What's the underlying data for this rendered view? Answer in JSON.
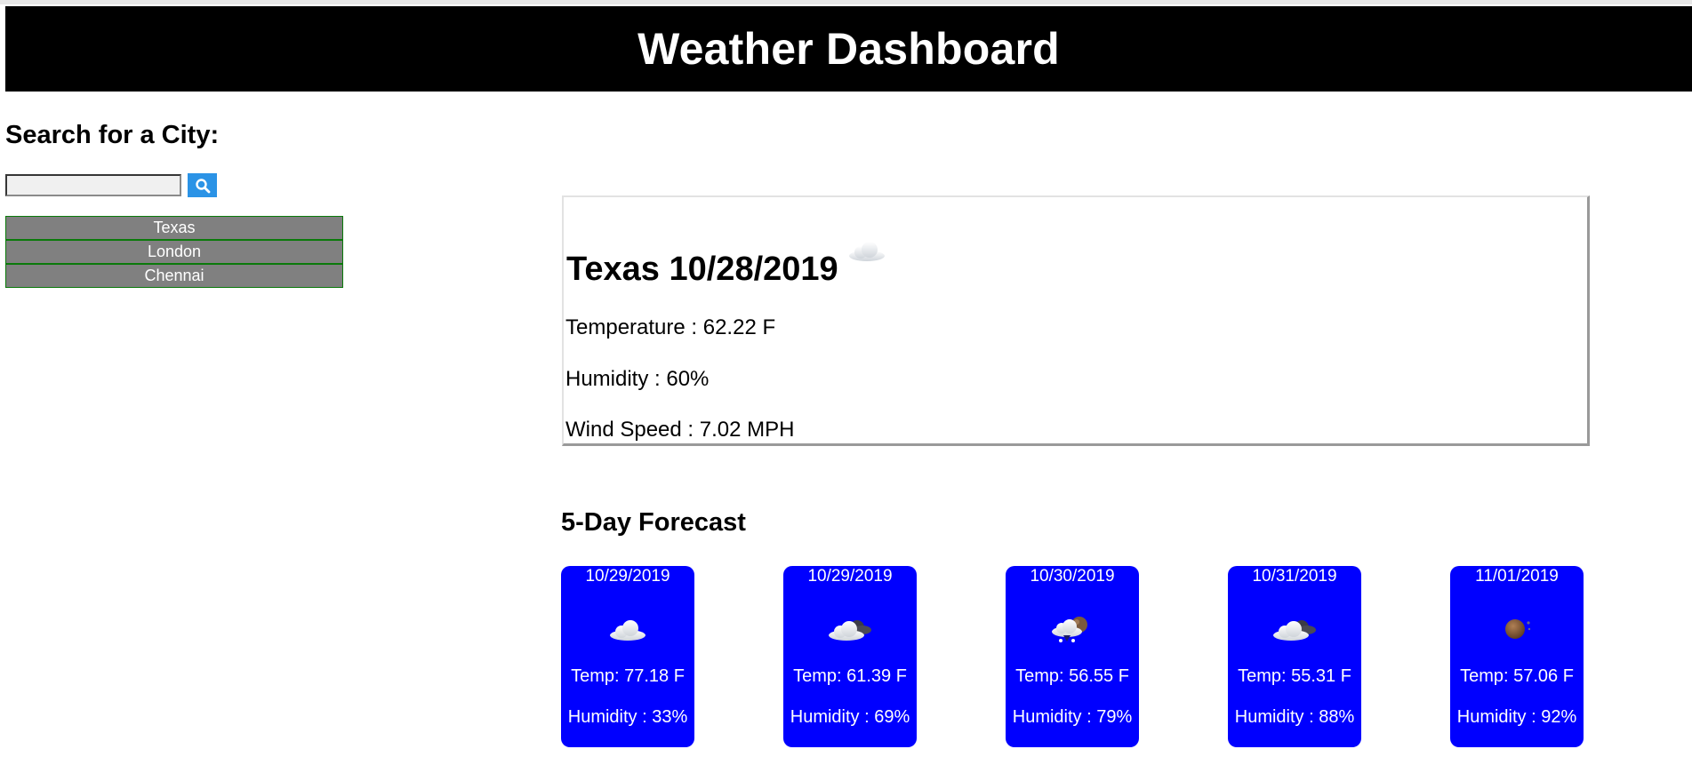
{
  "header": {
    "title": "Weather Dashboard"
  },
  "search": {
    "heading": "Search for a City:",
    "input_value": "",
    "button_icon": "search-icon"
  },
  "history": {
    "items": [
      {
        "label": "Texas"
      },
      {
        "label": "London"
      },
      {
        "label": "Chennai"
      }
    ]
  },
  "current": {
    "title": "Texas 10/28/2019",
    "icon": "cloud-icon",
    "temperature": "Temperature : 62.22 F",
    "humidity": "Humidity : 60%",
    "wind": "Wind Speed : 7.02 MPH"
  },
  "forecast": {
    "heading": "5-Day Forecast",
    "days": [
      {
        "date": "10/29/2019",
        "icon": "cloud-icon",
        "temp": "Temp: 77.18 F",
        "humidity": "Humidity : 33%"
      },
      {
        "date": "10/29/2019",
        "icon": "dark-cloud-icon",
        "temp": "Temp: 61.39 F",
        "humidity": "Humidity : 69%"
      },
      {
        "date": "10/30/2019",
        "icon": "snow-cloud-icon",
        "temp": "Temp: 56.55 F",
        "humidity": "Humidity : 79%"
      },
      {
        "date": "10/31/2019",
        "icon": "dark-cloud-icon",
        "temp": "Temp: 55.31 F",
        "humidity": "Humidity : 88%"
      },
      {
        "date": "11/01/2019",
        "icon": "moon-icon",
        "temp": "Temp: 57.06 F",
        "humidity": "Humidity : 92%"
      }
    ]
  },
  "colors": {
    "header_bg": "#000000",
    "search_button": "#2b93e6",
    "history_item_bg": "#808080",
    "history_item_border": "#0a7a0a",
    "forecast_card_bg": "#0000ff"
  }
}
